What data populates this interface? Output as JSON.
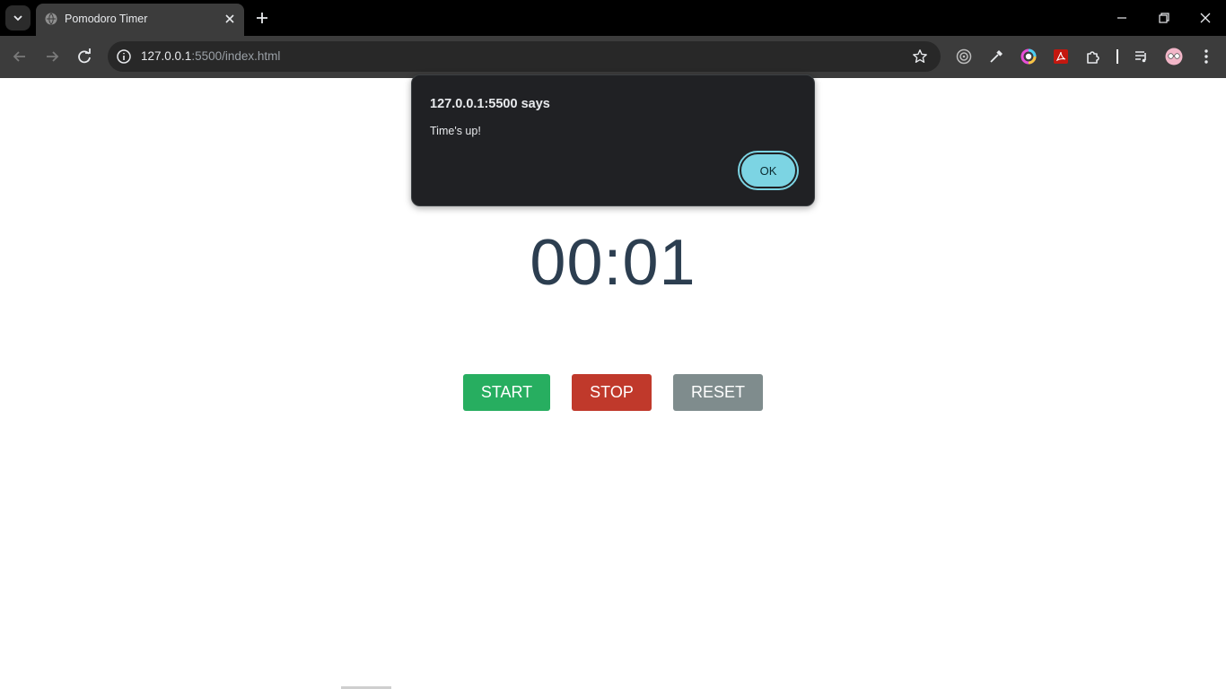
{
  "browser": {
    "tab_title": "Pomodoro Timer",
    "url_host": "127.0.0.1",
    "url_rest": ":5500/index.html",
    "icons": {
      "tab_search": "chevron-down-icon",
      "favicon": "globe-icon",
      "tab_close": "close-icon",
      "new_tab": "plus-icon",
      "back": "arrow-left-icon",
      "forward": "arrow-right-icon",
      "reload": "reload-icon",
      "site_info": "info-icon",
      "bookmark": "star-icon",
      "extensions": [
        "target-icon",
        "eyedropper-icon",
        "color-wheel-icon",
        "pdf-icon",
        "puzzle-icon",
        "media-queue-icon",
        "profile-avatar-icon",
        "more-vert-icon"
      ]
    }
  },
  "page": {
    "timer": "00:01",
    "buttons": {
      "start": "START",
      "stop": "STOP",
      "reset": "RESET"
    },
    "colors": {
      "start": "#27ae60",
      "stop": "#c0392b",
      "reset": "#7f8c8d",
      "timer_text": "#2c3e50"
    }
  },
  "dialog": {
    "title": "127.0.0.1:5500 says",
    "message": "Time's up!",
    "ok_label": "OK",
    "ok_color": "#7cd4e3"
  }
}
